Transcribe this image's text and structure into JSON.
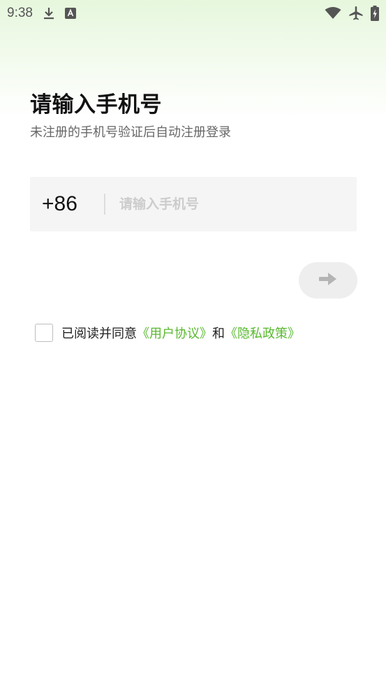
{
  "status_bar": {
    "time": "9:38",
    "left_icons": [
      "download-icon",
      "keyboard-a-icon"
    ],
    "right_icons": [
      "wifi-icon",
      "airplane-icon",
      "battery-icon"
    ]
  },
  "login": {
    "title": "请输入手机号",
    "subtitle": "未注册的手机号验证后自动注册登录",
    "country_code": "+86",
    "phone_placeholder": "请输入手机号",
    "phone_value": "",
    "next_button_icon": "arrow-right-icon"
  },
  "agreement": {
    "checked": false,
    "prefix": "已阅读并同意",
    "user_agreement": "《用户协议》",
    "and": "和",
    "privacy_policy": "《隐私政策》"
  },
  "colors": {
    "accent_green": "#58b82e",
    "top_gradient": "#e6f7dd",
    "input_bg": "#f5f5f5",
    "button_disabled_bg": "#eeeeee"
  }
}
